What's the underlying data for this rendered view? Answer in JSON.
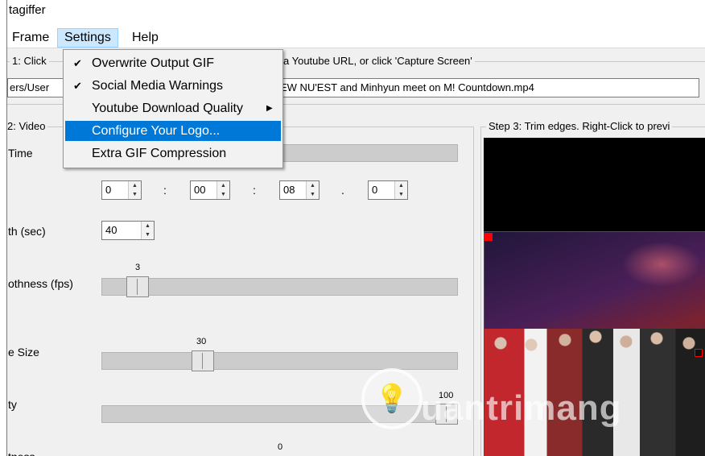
{
  "window": {
    "title": "tagiffer"
  },
  "menu": {
    "frame": "Frame",
    "settings": "Settings",
    "help": "Help"
  },
  "settings_menu": {
    "overwrite_output_gif": {
      "label": "Overwrite Output GIF",
      "check": "✔",
      "checked": true
    },
    "social_media_warnings": {
      "label": "Social Media Warnings",
      "check": "✔",
      "checked": true
    },
    "youtube_download_quality": {
      "label": "Youtube Download Quality",
      "submenu_arrow": "▶"
    },
    "configure_your_logo": {
      "label": "Configure Your Logo...",
      "highlighted": true
    },
    "extra_gif_compression": {
      "label": "Extra GIF Compression"
    }
  },
  "step1": {
    "prefix": "1: Click",
    "suffix": "a Youtube URL, or click 'Capture Screen'"
  },
  "video_path": {
    "prefix": "ers/User",
    "filename": "EW NU'EST and Minhyun meet on M! Countdown.mp4"
  },
  "step2": {
    "title": "2: Video",
    "start_time_label": "Time",
    "time_fields": [
      "0",
      "00",
      "08",
      "0"
    ],
    "time_separators": [
      ":",
      ":",
      "."
    ],
    "length_label": "th (sec)",
    "length_value": "40",
    "smoothness_label": "othness (fps)",
    "smoothness_value": "3",
    "size_label": "e Size",
    "size_value": "30",
    "quality_label": "ty",
    "quality_value": "100",
    "last_label": "tness",
    "last_value": "0"
  },
  "step3": {
    "title": "Step 3: Trim edges. Right-Click to previ"
  },
  "watermark": {
    "glyph": "💡",
    "text": "uantrimang"
  },
  "colors": {
    "menu_highlight": "#0078d7",
    "menu_active": "#cce8ff",
    "crop_border": "#e01010"
  },
  "icons": {
    "check": "checkmark-icon",
    "submenu": "submenu-arrow-icon",
    "spin": "spin-arrows-icon"
  }
}
